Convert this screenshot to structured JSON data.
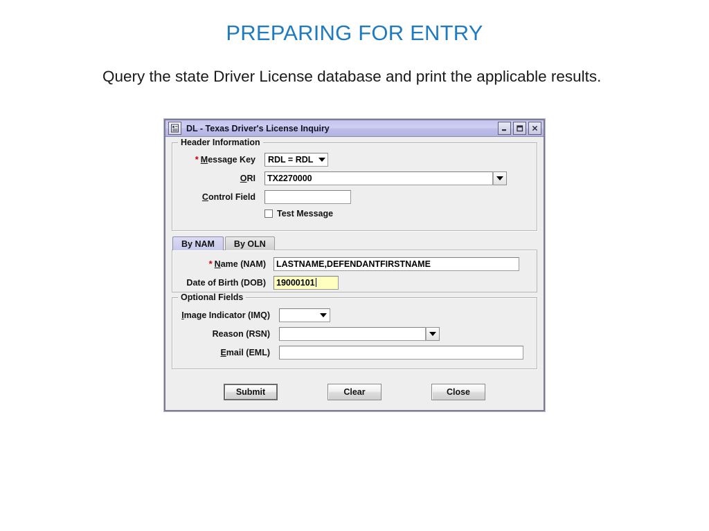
{
  "slide": {
    "title": "PREPARING FOR ENTRY",
    "subtitle": "Query the state Driver License database and print the applicable results.",
    "title_color": "#1F7BC1"
  },
  "dialog": {
    "title": "DL - Texas Driver's License Inquiry",
    "window_icon": "form-document-icon",
    "window_buttons": {
      "minimize": "minimize-icon",
      "maximize": "maximize-icon",
      "close": "close-icon"
    },
    "header_group": {
      "title": "Header Information",
      "message_key": {
        "label": "Message Key",
        "label_mnemonic": "M",
        "label_rest": "essage Key",
        "required": "*",
        "value": "RDL = RDL"
      },
      "ori": {
        "label_mnemonic": "O",
        "label_rest": "RI",
        "value": "TX2270000"
      },
      "control_field": {
        "label_mnemonic": "C",
        "label_rest": "ontrol Field",
        "value": ""
      },
      "test_message": {
        "label": "Test Message",
        "checked": false
      }
    },
    "tabs": [
      {
        "label": "By NAM",
        "selected": true
      },
      {
        "label": "By OLN",
        "selected": false
      }
    ],
    "tab_panel": {
      "name": {
        "required": "*",
        "label_mnemonic": "N",
        "label_rest": "ame (NAM)",
        "value": "LASTNAME,DEFENDANTFIRSTNAME"
      },
      "dob": {
        "label": "Date of Birth (DOB)",
        "value": "19000101",
        "highlight_color": "#ffffbf",
        "focused": true
      }
    },
    "optional_group": {
      "title": "Optional Fields",
      "image_indicator": {
        "label_mnemonic": "I",
        "label_rest": "mage Indicator (IMQ)",
        "value": ""
      },
      "reason": {
        "label": "Reason (RSN)",
        "value": ""
      },
      "email": {
        "label_mnemonic": "E",
        "label_rest": "mail (EML)",
        "value": ""
      }
    },
    "buttons": [
      {
        "label": "Submit",
        "focused": true
      },
      {
        "label": "Clear",
        "focused": false
      },
      {
        "label": "Close",
        "focused": false
      }
    ]
  }
}
